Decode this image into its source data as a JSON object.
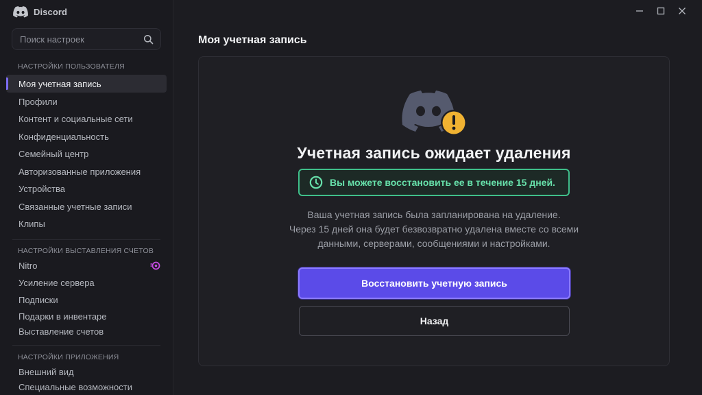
{
  "app": {
    "name": "Discord"
  },
  "colors": {
    "accent": "#5b4be8",
    "success": "#3fbf8a",
    "warning": "#f0b232",
    "nitro": "#c44be0"
  },
  "sidebar": {
    "search_placeholder": "Поиск настроек",
    "sections": [
      {
        "title": "НАСТРОЙКИ ПОЛЬЗОВАТЕЛЯ",
        "items": [
          {
            "label": "Моя учетная запись",
            "active": true
          },
          {
            "label": "Профили"
          },
          {
            "label": "Контент и социальные сети"
          },
          {
            "label": "Конфиденциальность"
          },
          {
            "label": "Семейный центр"
          },
          {
            "label": "Авторизованные приложения"
          },
          {
            "label": "Устройства"
          },
          {
            "label": "Связанные учетные записи"
          },
          {
            "label": "Клипы"
          }
        ]
      },
      {
        "title": "НАСТРОЙКИ ВЫСТАВЛЕНИЯ СЧЕТОВ",
        "items": [
          {
            "label": "Nitro",
            "icon": "nitro-icon"
          },
          {
            "label": "Усиление сервера"
          },
          {
            "label": "Подписки"
          },
          {
            "label": "Подарки в инвентаре"
          },
          {
            "label": "Выставление счетов"
          }
        ]
      },
      {
        "title": "НАСТРОЙКИ ПРИЛОЖЕНИЯ",
        "items": [
          {
            "label": "Внешний вид"
          },
          {
            "label": "Специальные возможности"
          }
        ]
      }
    ]
  },
  "main": {
    "page_title": "Моя учетная запись",
    "headline": "Учетная запись ожидает удаления",
    "notice": "Вы можете восстановить ее в течение 15 дней.",
    "description": [
      "Ваша учетная запись была запланирована на удаление.",
      "Через 15 дней она будет безвозвратно удалена вместе со всеми",
      "данными, серверами, сообщениями и настройками."
    ],
    "restore_button": "Восстановить учетную запись",
    "back_button": "Назад"
  }
}
